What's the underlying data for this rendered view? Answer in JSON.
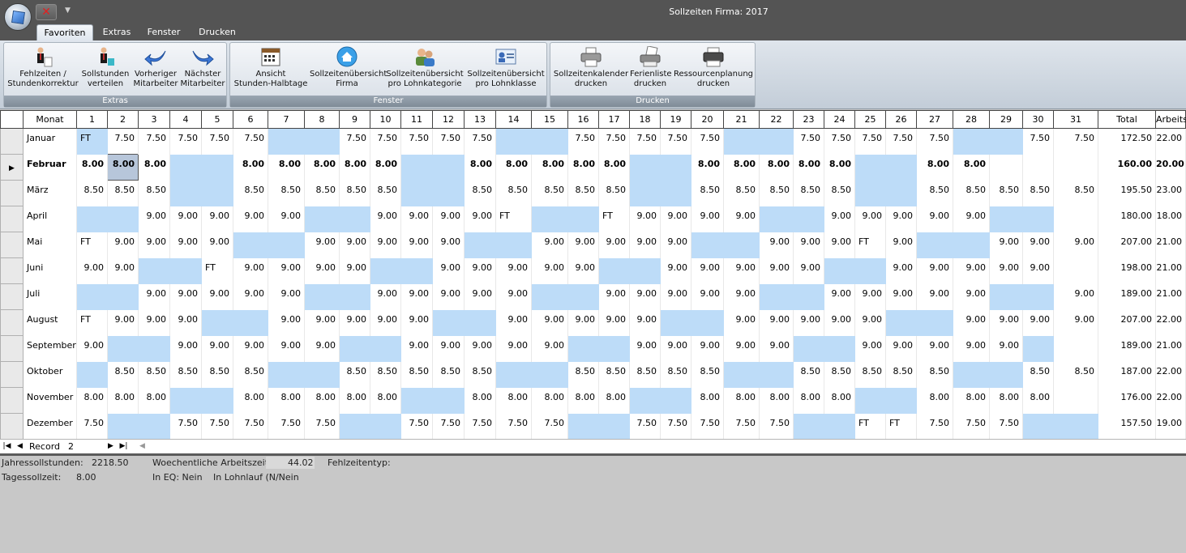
{
  "window": {
    "title": "Sollzeiten Firma: 2017"
  },
  "tabs": [
    "Favoriten",
    "Extras",
    "Fenster",
    "Drucken"
  ],
  "ribbon": {
    "groups": [
      {
        "label": "Extras",
        "buttons": [
          {
            "line1": "Fehlzeiten /",
            "line2": "Stundenkorrektur",
            "icon": "person-doc-icon"
          },
          {
            "line1": "Sollstunden",
            "line2": "verteilen",
            "icon": "person-distribute-icon"
          },
          {
            "line1": "Vorheriger",
            "line2": "Mitarbeiter",
            "icon": "arrow-back-icon"
          },
          {
            "line1": "Nächster",
            "line2": "Mitarbeiter",
            "icon": "arrow-forward-icon"
          }
        ]
      },
      {
        "label": "Fenster",
        "buttons": [
          {
            "line1": "Ansicht",
            "line2": "Stunden-Halbtage",
            "icon": "calendar-icon"
          },
          {
            "line1": "Sollzeitenübersicht",
            "line2": "Firma",
            "icon": "home-icon"
          },
          {
            "line1": "Sollzeitenübersicht",
            "line2": "pro Lohnkategorie",
            "icon": "people-icon"
          },
          {
            "line1": "Sollzeitenübersicht",
            "line2": "pro Lohnklasse",
            "icon": "id-card-icon"
          }
        ]
      },
      {
        "label": "Drucken",
        "buttons": [
          {
            "line1": "Sollzeitenkalender",
            "line2": "drucken",
            "icon": "printer-icon"
          },
          {
            "line1": "Ferienliste",
            "line2": "drucken",
            "icon": "printer-list-icon"
          },
          {
            "line1": "Ressourcenplanung",
            "line2": "drucken",
            "icon": "printer-icon"
          }
        ]
      }
    ]
  },
  "grid": {
    "headers": [
      "Monat",
      "1",
      "2",
      "3",
      "4",
      "5",
      "6",
      "7",
      "8",
      "9",
      "10",
      "11",
      "12",
      "13",
      "14",
      "15",
      "16",
      "17",
      "18",
      "19",
      "20",
      "21",
      "22",
      "23",
      "24",
      "25",
      "26",
      "27",
      "28",
      "29",
      "30",
      "31",
      "Total",
      "Arbeitstage"
    ],
    "rows": [
      {
        "month": "Januar",
        "cells": [
          "FT",
          "7.50",
          "7.50",
          "7.50",
          "7.50",
          "7.50",
          "",
          "",
          "7.50",
          "7.50",
          "7.50",
          "7.50",
          "7.50",
          "",
          "",
          "7.50",
          "7.50",
          "7.50",
          "7.50",
          "7.50",
          "",
          "",
          "7.50",
          "7.50",
          "7.50",
          "7.50",
          "7.50",
          "",
          "",
          "7.50",
          "7.50"
        ],
        "we": [
          1,
          7,
          8,
          14,
          15,
          21,
          22,
          28,
          29
        ],
        "total": "172.50",
        "days": "22.00"
      },
      {
        "month": "Februar",
        "cells": [
          "8.00",
          "8.00",
          "8.00",
          "",
          "",
          "8.00",
          "8.00",
          "8.00",
          "8.00",
          "8.00",
          "",
          "",
          "8.00",
          "8.00",
          "8.00",
          "8.00",
          "8.00",
          "",
          "",
          "8.00",
          "8.00",
          "8.00",
          "8.00",
          "8.00",
          "",
          "",
          "8.00",
          "8.00",
          "",
          "",
          ""
        ],
        "we": [
          4,
          5,
          11,
          12,
          18,
          19,
          25,
          26
        ],
        "total": "160.00",
        "days": "20.00",
        "bold": true,
        "current": true,
        "selected_day": 2
      },
      {
        "month": "März",
        "cells": [
          "8.50",
          "8.50",
          "8.50",
          "",
          "",
          "8.50",
          "8.50",
          "8.50",
          "8.50",
          "8.50",
          "",
          "",
          "8.50",
          "8.50",
          "8.50",
          "8.50",
          "8.50",
          "",
          "",
          "8.50",
          "8.50",
          "8.50",
          "8.50",
          "8.50",
          "",
          "",
          "8.50",
          "8.50",
          "8.50",
          "8.50",
          "8.50"
        ],
        "we": [
          4,
          5,
          11,
          12,
          18,
          19,
          25,
          26
        ],
        "total": "195.50",
        "days": "23.00"
      },
      {
        "month": "April",
        "cells": [
          "",
          "",
          "9.00",
          "9.00",
          "9.00",
          "9.00",
          "9.00",
          "",
          "",
          "9.00",
          "9.00",
          "9.00",
          "9.00",
          "FT",
          "",
          "",
          "FT",
          "9.00",
          "9.00",
          "9.00",
          "9.00",
          "",
          "",
          "9.00",
          "9.00",
          "9.00",
          "9.00",
          "9.00",
          "",
          "",
          ""
        ],
        "we": [
          1,
          2,
          8,
          9,
          15,
          16,
          22,
          23,
          29,
          30
        ],
        "total": "180.00",
        "days": "18.00"
      },
      {
        "month": "Mai",
        "cells": [
          "FT",
          "9.00",
          "9.00",
          "9.00",
          "9.00",
          "",
          "",
          "9.00",
          "9.00",
          "9.00",
          "9.00",
          "9.00",
          "",
          "",
          "9.00",
          "9.00",
          "9.00",
          "9.00",
          "9.00",
          "",
          "",
          "9.00",
          "9.00",
          "9.00",
          "FT",
          "9.00",
          "",
          "",
          "9.00",
          "9.00",
          "9.00"
        ],
        "we": [
          6,
          7,
          13,
          14,
          20,
          21,
          27,
          28
        ],
        "total": "207.00",
        "days": "21.00"
      },
      {
        "month": "Juni",
        "cells": [
          "9.00",
          "9.00",
          "",
          "",
          "FT",
          "9.00",
          "9.00",
          "9.00",
          "9.00",
          "",
          "",
          "9.00",
          "9.00",
          "9.00",
          "9.00",
          "9.00",
          "",
          "",
          "9.00",
          "9.00",
          "9.00",
          "9.00",
          "9.00",
          "",
          "",
          "9.00",
          "9.00",
          "9.00",
          "9.00",
          "9.00",
          ""
        ],
        "we": [
          3,
          4,
          10,
          11,
          17,
          18,
          24,
          25
        ],
        "total": "198.00",
        "days": "21.00"
      },
      {
        "month": "Juli",
        "cells": [
          "",
          "",
          "9.00",
          "9.00",
          "9.00",
          "9.00",
          "9.00",
          "",
          "",
          "9.00",
          "9.00",
          "9.00",
          "9.00",
          "9.00",
          "",
          "",
          "9.00",
          "9.00",
          "9.00",
          "9.00",
          "9.00",
          "",
          "",
          "9.00",
          "9.00",
          "9.00",
          "9.00",
          "9.00",
          "",
          "",
          "9.00"
        ],
        "we": [
          1,
          2,
          8,
          9,
          15,
          16,
          22,
          23,
          29,
          30
        ],
        "total": "189.00",
        "days": "21.00"
      },
      {
        "month": "August",
        "cells": [
          "FT",
          "9.00",
          "9.00",
          "9.00",
          "",
          "",
          "9.00",
          "9.00",
          "9.00",
          "9.00",
          "9.00",
          "",
          "",
          "9.00",
          "9.00",
          "9.00",
          "9.00",
          "9.00",
          "",
          "",
          "9.00",
          "9.00",
          "9.00",
          "9.00",
          "9.00",
          "",
          "",
          "9.00",
          "9.00",
          "9.00",
          "9.00"
        ],
        "we": [
          5,
          6,
          12,
          13,
          19,
          20,
          26,
          27
        ],
        "total": "207.00",
        "days": "22.00"
      },
      {
        "month": "September",
        "cells": [
          "9.00",
          "",
          "",
          "9.00",
          "9.00",
          "9.00",
          "9.00",
          "9.00",
          "",
          "",
          "9.00",
          "9.00",
          "9.00",
          "9.00",
          "9.00",
          "",
          "",
          "9.00",
          "9.00",
          "9.00",
          "9.00",
          "9.00",
          "",
          "",
          "9.00",
          "9.00",
          "9.00",
          "9.00",
          "9.00",
          "",
          ""
        ],
        "we": [
          2,
          3,
          9,
          10,
          16,
          17,
          23,
          24,
          30
        ],
        "total": "189.00",
        "days": "21.00"
      },
      {
        "month": "Oktober",
        "cells": [
          "",
          "8.50",
          "8.50",
          "8.50",
          "8.50",
          "8.50",
          "",
          "",
          "8.50",
          "8.50",
          "8.50",
          "8.50",
          "8.50",
          "",
          "",
          "8.50",
          "8.50",
          "8.50",
          "8.50",
          "8.50",
          "",
          "",
          "8.50",
          "8.50",
          "8.50",
          "8.50",
          "8.50",
          "",
          "",
          "8.50",
          "8.50"
        ],
        "we": [
          1,
          7,
          8,
          14,
          15,
          21,
          22,
          28,
          29
        ],
        "total": "187.00",
        "days": "22.00"
      },
      {
        "month": "November",
        "cells": [
          "8.00",
          "8.00",
          "8.00",
          "",
          "",
          "8.00",
          "8.00",
          "8.00",
          "8.00",
          "8.00",
          "",
          "",
          "8.00",
          "8.00",
          "8.00",
          "8.00",
          "8.00",
          "",
          "",
          "8.00",
          "8.00",
          "8.00",
          "8.00",
          "8.00",
          "",
          "",
          "8.00",
          "8.00",
          "8.00",
          "8.00",
          ""
        ],
        "we": [
          4,
          5,
          11,
          12,
          18,
          19,
          25,
          26
        ],
        "total": "176.00",
        "days": "22.00"
      },
      {
        "month": "Dezember",
        "cells": [
          "7.50",
          "",
          "",
          "7.50",
          "7.50",
          "7.50",
          "7.50",
          "7.50",
          "",
          "",
          "7.50",
          "7.50",
          "7.50",
          "7.50",
          "7.50",
          "",
          "",
          "7.50",
          "7.50",
          "7.50",
          "7.50",
          "7.50",
          "",
          "",
          "FT",
          "FT",
          "7.50",
          "7.50",
          "7.50",
          "",
          ""
        ],
        "we": [
          2,
          3,
          9,
          10,
          16,
          17,
          23,
          24,
          30,
          31
        ],
        "total": "157.50",
        "days": "19.00"
      }
    ]
  },
  "navigator": {
    "record_label": "Record",
    "record_value": "2"
  },
  "status": {
    "jahres_label": "Jahressollstunden:",
    "jahres_value": "2218.50",
    "woch_label": "Woechentliche Arbeitszeit",
    "woch_value": "44.02",
    "fehl_label": "Fehlzeitentyp:",
    "tages_label": "Tagessollzeit:",
    "tages_value": "8.00",
    "eq_label": "In EQ: Nein",
    "lohn_label": "In Lohnlauf (N/Nein"
  },
  "colors": {
    "weekend": "#bddcf8",
    "selected_cell": "#b7c6da",
    "titlebar": "#545454"
  }
}
